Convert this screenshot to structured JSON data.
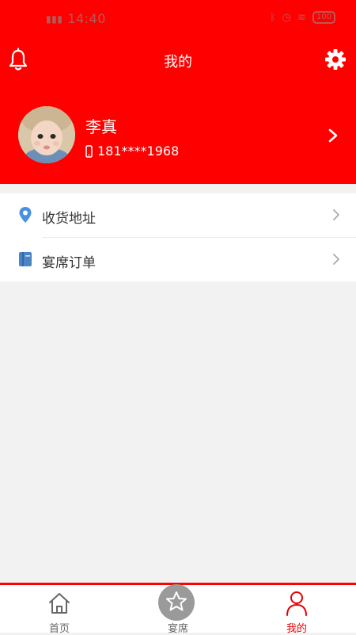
{
  "status_bar": {
    "time": "14:40",
    "battery": "100"
  },
  "header": {
    "title": "我的"
  },
  "profile": {
    "name": "李真",
    "phone": "181****1968"
  },
  "menu": {
    "items": [
      {
        "label": "收货地址",
        "icon": "location-pin-icon"
      },
      {
        "label": "宴席订单",
        "icon": "book-icon"
      }
    ]
  },
  "tabbar": {
    "tabs": [
      {
        "label": "首页",
        "icon": "home-icon",
        "active": false
      },
      {
        "label": "宴席",
        "icon": "star-icon",
        "active": false
      },
      {
        "label": "我的",
        "icon": "user-icon",
        "active": true
      }
    ]
  },
  "colors": {
    "brand": "#ff0000",
    "active_tab": "#e60000",
    "pin_icon": "#4a90e2",
    "book_icon": "#4a86c5"
  }
}
